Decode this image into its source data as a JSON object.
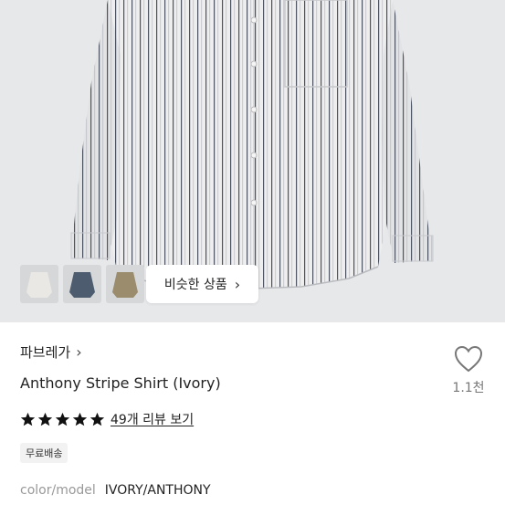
{
  "gallery": {
    "similar_button_label": "비슷한 상품",
    "thumbnails": [
      {
        "color": "#e4e3df",
        "label": "ivory"
      },
      {
        "color": "#4d5d6f",
        "label": "navy"
      },
      {
        "color": "#9a8c6c",
        "label": "khaki"
      }
    ]
  },
  "product": {
    "brand": "파브레가",
    "title": "Anthony Stripe Shirt (Ivory)",
    "like_count": "1.1천",
    "rating_stars": 5,
    "review_link": "49개 리뷰 보기",
    "shipping_badge": "무료배송",
    "meta_label": "color/model",
    "meta_value": "IVORY/ANTHONY"
  },
  "colors": {
    "star": "#111111",
    "hero_bg": "#e7e8ea"
  },
  "icons": {
    "like": "heart-outline-icon",
    "chevron": "chevron-right-icon",
    "star": "star-icon"
  }
}
